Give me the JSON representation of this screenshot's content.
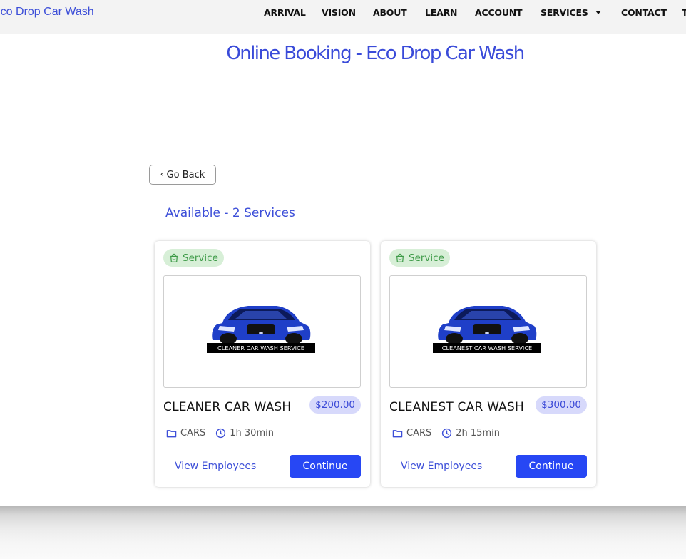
{
  "header": {
    "logo_text": "Eco Drop Car Wash",
    "nav": [
      {
        "label": "ARRIVAL"
      },
      {
        "label": "VISION"
      },
      {
        "label": "ABOUT"
      },
      {
        "label": "LEARN"
      },
      {
        "label": "ACCOUNT"
      },
      {
        "label": "SERVICES",
        "has_dropdown": true
      },
      {
        "label": "CONTACT"
      }
    ]
  },
  "page": {
    "title": "Online Booking - Eco Drop Car Wash",
    "go_back_label": "Go Back",
    "go_back_icon": "chevron-left-icon",
    "available_text": "Available - 2 Services"
  },
  "services": [
    {
      "badge": "Service",
      "badge_icon": "shopping-bag-icon",
      "image_caption": "CLEANER CAR WASH SERVICE",
      "name": "CLEANER CAR WASH",
      "price": "$200.00",
      "category": "CARS",
      "duration": "1h 30min",
      "view_employees_label": "View Employees",
      "continue_label": "Continue"
    },
    {
      "badge": "Service",
      "badge_icon": "shopping-bag-icon",
      "image_caption": "CLEANEST CAR WASH SERVICE",
      "name": "CLEANEST CAR WASH",
      "price": "$300.00",
      "category": "CARS",
      "duration": "2h 15min",
      "view_employees_label": "View Employees",
      "continue_label": "Continue"
    }
  ],
  "colors": {
    "accent_blue": "#3a4bd9",
    "button_blue": "#2747f4",
    "badge_green_bg": "#d7efd7",
    "badge_green_text": "#3d9a47",
    "price_bg": "#d7d9fb",
    "car_body": "#1f3fc8"
  }
}
